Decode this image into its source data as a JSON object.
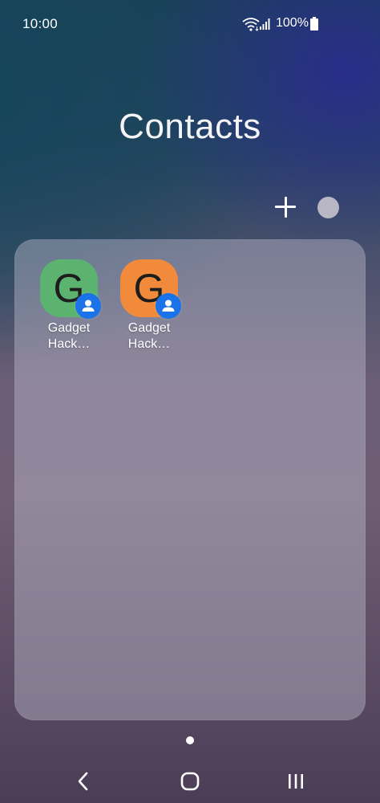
{
  "status_bar": {
    "time": "10:00",
    "battery": "100%",
    "icons": [
      "wifi-icon",
      "signal-icon",
      "battery-icon"
    ]
  },
  "folder": {
    "title": "Contacts",
    "actions": [
      "add-icon",
      "folder-color-icon"
    ]
  },
  "apps": [
    {
      "line1": "Gadget",
      "line2": "Hack…",
      "letter": "G",
      "color": "#5bb36f",
      "badge": "contact-badge-icon"
    },
    {
      "line1": "Gadget",
      "line2": "Hack…",
      "letter": "G",
      "color": "#f28a3c",
      "badge": "contact-badge-icon"
    }
  ],
  "navigation": {
    "buttons": [
      "back-icon",
      "home-icon",
      "recents-icon"
    ]
  },
  "colors": {
    "folder_color_swatch": "#b9b6c6",
    "badge_blue": "#1a73e8"
  }
}
